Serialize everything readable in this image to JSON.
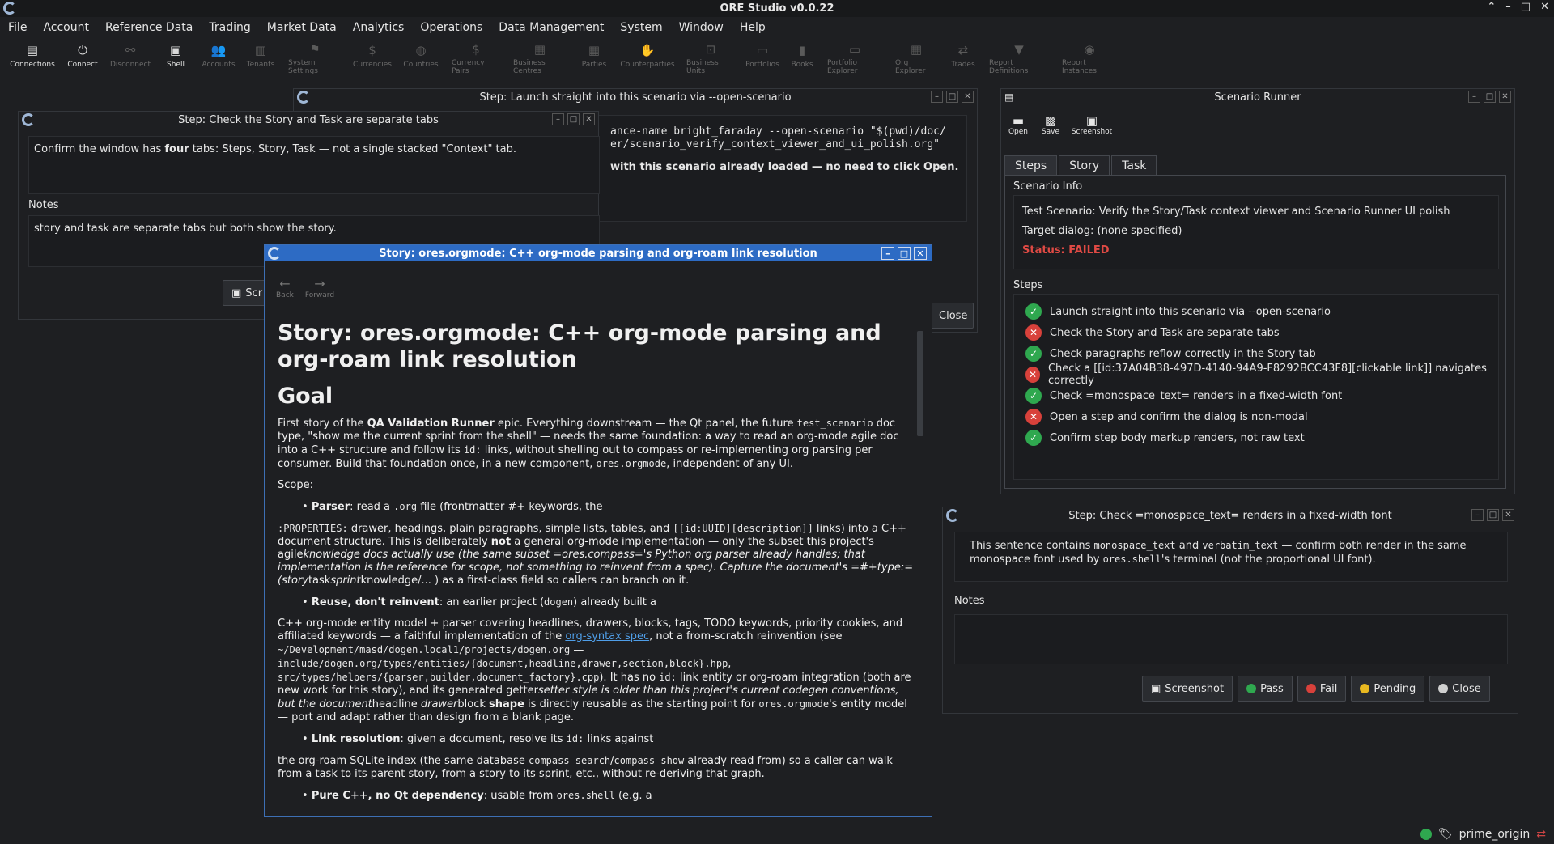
{
  "app": {
    "title": "ORE Studio v0.0.22"
  },
  "menu": [
    "File",
    "Account",
    "Reference Data",
    "Trading",
    "Market Data",
    "Analytics",
    "Operations",
    "Data Management",
    "System",
    "Window",
    "Help"
  ],
  "toolbar": [
    {
      "label": "Connections",
      "icon": "connections-icon",
      "enabled": true
    },
    {
      "label": "Connect",
      "icon": "connect-icon",
      "enabled": true
    },
    {
      "label": "Disconnect",
      "icon": "disconnect-icon",
      "enabled": false
    },
    {
      "label": "Shell",
      "icon": "shell-icon",
      "enabled": true
    },
    {
      "label": "Accounts",
      "icon": "accounts-icon",
      "enabled": false
    },
    {
      "label": "Tenants",
      "icon": "tenants-icon",
      "enabled": false
    },
    {
      "label": "System Settings",
      "icon": "flag-icon",
      "enabled": false
    },
    {
      "label": "Currencies",
      "icon": "currency-icon",
      "enabled": false
    },
    {
      "label": "Countries",
      "icon": "globe-icon",
      "enabled": false
    },
    {
      "label": "Currency Pairs",
      "icon": "currency-pairs-icon",
      "enabled": false
    },
    {
      "label": "Business Centres",
      "icon": "building-icon",
      "enabled": false
    },
    {
      "label": "Parties",
      "icon": "parties-icon",
      "enabled": false
    },
    {
      "label": "Counterparties",
      "icon": "handshake-icon",
      "enabled": false
    },
    {
      "label": "Business Units",
      "icon": "units-icon",
      "enabled": false
    },
    {
      "label": "Portfolios",
      "icon": "briefcase-icon",
      "enabled": false
    },
    {
      "label": "Books",
      "icon": "book-icon",
      "enabled": false
    },
    {
      "label": "Portfolio Explorer",
      "icon": "explorer-icon",
      "enabled": false
    },
    {
      "label": "Org Explorer",
      "icon": "org-icon",
      "enabled": false
    },
    {
      "label": "Trades",
      "icon": "trades-icon",
      "enabled": false
    },
    {
      "label": "Report Definitions",
      "icon": "report-def-icon",
      "enabled": false
    },
    {
      "label": "Report Instances",
      "icon": "report-inst-icon",
      "enabled": false
    }
  ],
  "launch_window": {
    "title": "Step: Launch straight into this scenario via --open-scenario",
    "line1": "ance-name bright_faraday --open-scenario \"$(pwd)/doc/",
    "line2": "er/scenario_verify_context_viewer_and_ui_polish.org\"",
    "line3": "with this scenario already loaded — no need to click Open.",
    "close_label": "Close"
  },
  "tabs_window": {
    "title": "Step: Check the Story and Task are separate tabs",
    "body_pre": "Confirm the window has ",
    "body_bold": "four",
    "body_post": " tabs: Steps, Story, Task — not a single stacked \"Context\" tab.",
    "notes_label": "Notes",
    "notes_text": "story and task are separate tabs but both show the story.",
    "screenshot_label": "Scr"
  },
  "story_dialog": {
    "title": "Story: ores.orgmode: C++ org-mode parsing and org-roam link resolution",
    "back_label": "Back",
    "forward_label": "Forward",
    "h1": "Story: ores.orgmode: C++ org-mode parsing and org-roam link resolution",
    "h2": "Goal",
    "p1_a": "First story of the ",
    "p1_b": "QA Validation Runner",
    "p1_c": " epic. Everything downstream — the Qt panel, the future ",
    "p1_code1": "test_scenario",
    "p1_d": " doc type, \"show me the current sprint from the shell\" — needs the same foundation: a way to read an org-mode agile doc into a C++ structure and follow its ",
    "p1_code2": "id:",
    "p1_e": " links, without shelling out to compass or re-implementing org parsing per consumer. Build that foundation once, in a new component, ",
    "p1_code3": "ores.orgmode",
    "p1_f": ", independent of any UI.",
    "scope": "Scope:",
    "b1_bold": "Parser",
    "b1_a": ": read a ",
    "b1_code": ".org",
    "b1_b": " file (frontmatter #+ keywords, the",
    "p2_code1": ":PROPERTIES:",
    "p2_a": " drawer, headings, plain paragraphs, simple lists, tables, and ",
    "p2_code2": "[[id:UUID][description]]",
    "p2_b": " links) into a C++ document structure. This is deliberately ",
    "p2_bold": "not",
    "p2_c": " a general org-mode implementation — only the subset this project's agile",
    "p2_i": "knowledge docs actually use (the same subset =ores.compass='s Python org parser already handles; that implementation is the reference for scope, not something to reinvent from a spec). Capture the document's =#+type:= (story",
    "p2_d": "task",
    "p2_i2": "sprint",
    "p2_e": "knowledge/... ) as a first-class field so callers can branch on it.",
    "b2_bold": "Reuse, don't reinvent",
    "b2_a": ": an earlier project (",
    "b2_code": "dogen",
    "b2_b": ") already built a",
    "p3_a": "C++ org-mode entity model + parser covering headlines, drawers, blocks, tags, TODO keywords, priority cookies, and affiliated keywords — a faithful implementation of the ",
    "p3_link": "org-syntax spec",
    "p3_b": ", not a from-scratch reinvention (see ",
    "p3_code1": "~/Development/masd/dogen.local1/projects/dogen.org",
    "p3_c": " — ",
    "p3_code2": "include/dogen.org/types/entities/{document,headline,drawer,section,block}.hpp",
    "p3_d": ", ",
    "p3_code3": "src/types/helpers/{parser,builder,document_factory}.cpp",
    "p3_e": "). It has no ",
    "p3_code4": "id:",
    "p3_f": " link entity or org-roam integration (both are new work for this story), and its generated getter",
    "p3_i": "setter style is older than this project's current codegen conventions, but the document",
    "p3_g": "headline ",
    "p3_i2": "drawer",
    "p3_h": "block ",
    "p3_bold": "shape",
    "p3_j": " is directly reusable as the starting point for ",
    "p3_code5": "ores.orgmode",
    "p3_k": "'s entity model — port and adapt rather than design from a blank page.",
    "b3_bold": "Link resolution",
    "b3_a": ": given a document, resolve its ",
    "b3_code": "id:",
    "b3_b": " links against",
    "p4_a": "the org-roam SQLite index (the same database ",
    "p4_code1": "compass search",
    "p4_b": "/",
    "p4_code2": "compass show",
    "p4_c": " already read from) so a caller can walk from a task to its parent story, from a story to its sprint, etc., without re-deriving that graph.",
    "b4_bold": "Pure C++, no Qt dependency",
    "b4_a": ": usable from ",
    "b4_code": "ores.shell",
    "b4_b": " (e.g. a"
  },
  "scenario_runner": {
    "title": "Scenario Runner",
    "tools": [
      "Open",
      "Save",
      "Screenshot"
    ],
    "tabs": [
      "Steps",
      "Story",
      "Task"
    ],
    "info_label": "Scenario Info",
    "info_line1": "Test Scenario: Verify the Story/Task context viewer and Scenario Runner UI polish",
    "info_line2": "Target dialog: (none specified)",
    "status": "Status: FAILED",
    "steps_label": "Steps",
    "steps": [
      {
        "text": "Launch straight into this scenario via --open-scenario",
        "result": "pass"
      },
      {
        "text": "Check the Story and Task are separate tabs",
        "result": "fail"
      },
      {
        "text": "Check paragraphs reflow correctly in the Story tab",
        "result": "pass"
      },
      {
        "text": "Check a [[id:37A04B38-497D-4140-94A9-F8292BCC43F8][clickable link]] navigates correctly",
        "result": "fail"
      },
      {
        "text": "Check =monospace_text= renders in a fixed-width font",
        "result": "pass"
      },
      {
        "text": "Open a step and confirm the dialog is non-modal",
        "result": "fail"
      },
      {
        "text": "Confirm step body markup renders, not raw text",
        "result": "pass"
      }
    ],
    "colors": {
      "pass": "#2fa84f",
      "fail": "#d8413b",
      "status": "#e04a44"
    }
  },
  "mono_window": {
    "title": "Step: Check =monospace_text= renders in a fixed-width font",
    "body_a": "This sentence contains ",
    "body_code1": "monospace_text",
    "body_b": " and ",
    "body_code2": "verbatim_text",
    "body_c": " — confirm both render in the same monospace font used by ",
    "body_code3": "ores.shell",
    "body_d": "'s terminal (not the proportional UI font).",
    "notes_label": "Notes",
    "buttons": {
      "screenshot": "Screenshot",
      "pass": "Pass",
      "fail": "Fail",
      "pending": "Pending",
      "close": "Close"
    }
  },
  "statusbar": {
    "user": "prime_origin"
  }
}
